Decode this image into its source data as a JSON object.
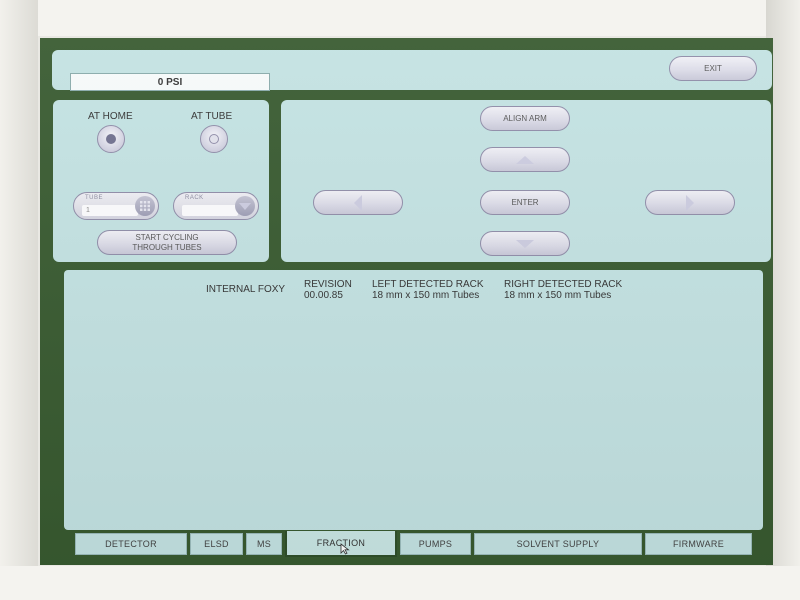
{
  "header": {
    "pressure": "0 PSI",
    "exit_label": "EXIT"
  },
  "position": {
    "at_home_label": "AT HOME",
    "at_tube_label": "AT TUBE",
    "selected": "AT HOME",
    "tube_field_label": "TUBE",
    "tube_value": "1",
    "rack_field_label": "RACK",
    "rack_value": "",
    "cycle_button_line1": "START CYCLING",
    "cycle_button_line2": "THROUGH TUBES"
  },
  "arm": {
    "align_label": "ALIGN ARM",
    "enter_label": "ENTER"
  },
  "info": {
    "internal_label": "INTERNAL FOXY",
    "revision_header": "REVISION",
    "revision_value": "00.00.85",
    "left_rack_header": "LEFT DETECTED RACK",
    "left_rack_value": "18 mm x 150 mm Tubes",
    "right_rack_header": "RIGHT DETECTED RACK",
    "right_rack_value": "18 mm x 150 mm Tubes"
  },
  "tabs": [
    {
      "label": "DETECTOR"
    },
    {
      "label": "ELSD"
    },
    {
      "label": "MS"
    },
    {
      "label": "FRACTION"
    },
    {
      "label": "PUMPS"
    },
    {
      "label": "SOLVENT SUPPLY"
    },
    {
      "label": "FIRMWARE"
    }
  ],
  "active_tab": "FRACTION",
  "colors": {
    "panel": "#c3e2e2",
    "screen_frame": "#385a30",
    "button_border": "#8f8ca8"
  }
}
